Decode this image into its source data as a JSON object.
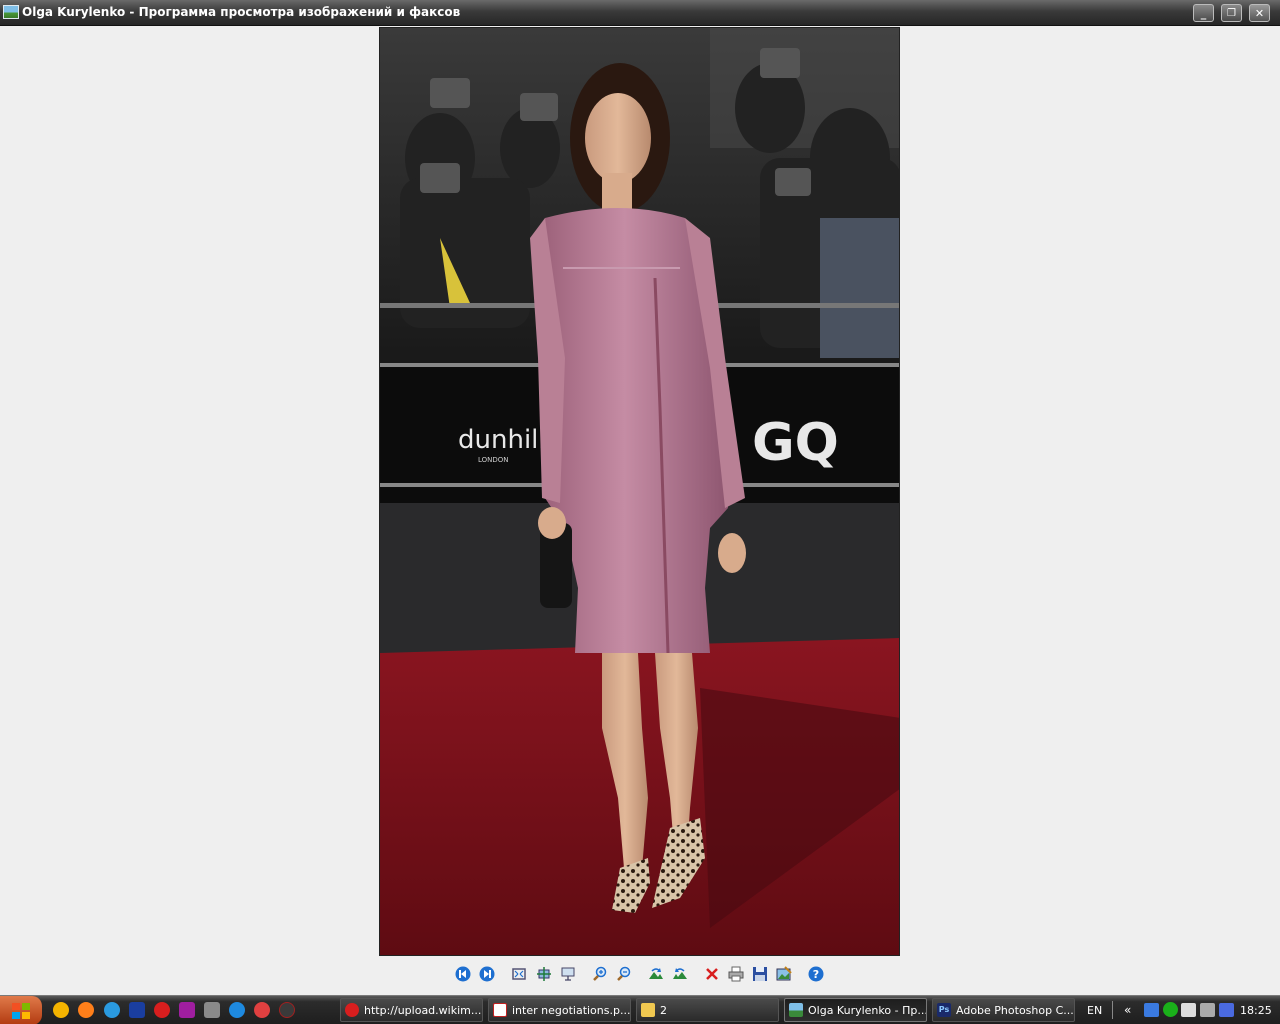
{
  "window": {
    "title": "Olga Kurylenko - Программа просмотра изображений и факсов",
    "minimize_glyph": "_",
    "maximize_glyph": "❐",
    "close_glyph": "✕"
  },
  "photo": {
    "sign_text_1": "dunhill",
    "sign_text_2": "LONDON",
    "sign_text_3": "GQ"
  },
  "toolbar": {
    "buttons": [
      "previous-image",
      "next-image",
      "best-fit",
      "actual-size",
      "slideshow",
      "zoom-in",
      "zoom-out",
      "rotate-clockwise",
      "rotate-counterclockwise",
      "delete",
      "print",
      "copy-to",
      "edit",
      "help"
    ]
  },
  "taskbar": {
    "tasks": [
      {
        "label": "http://upload.wikim...",
        "icon": "opera-icon"
      },
      {
        "label": "inter negotiations.p...",
        "icon": "pdf-icon"
      },
      {
        "label": "2",
        "icon": "folder-icon"
      },
      {
        "label": "Olga Kurylenko - Пр...",
        "icon": "image-viewer-icon"
      },
      {
        "label": "Adobe Photoshop C...",
        "icon": "photoshop-icon"
      }
    ],
    "language": "EN",
    "tray_arrows": "«",
    "clock": "18:25",
    "ps_badge": "Ps"
  },
  "colors": {
    "carpet": "#7a1018",
    "dress": "#b77a94",
    "toolbar_blue": "#1e6fd0"
  }
}
